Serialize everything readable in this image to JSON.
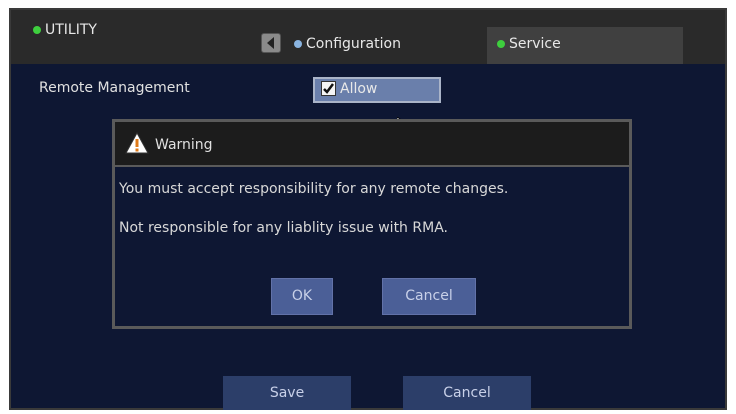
{
  "header": {
    "title": "UTILITY",
    "title_dot_color": "#3ecf3e",
    "back_icon": "chevron-left-icon",
    "tabs": [
      {
        "label": "Configuration",
        "dot_color": "#8ab4e0"
      },
      {
        "label": "Service",
        "dot_color": "#3ecf3e"
      }
    ]
  },
  "settings": {
    "remote_label": "Remote Management",
    "allow_label": "Allow",
    "allow_checked": true
  },
  "dialog": {
    "title": "Warning",
    "icon": "warning-icon",
    "line1": "You must accept responsibility for any remote changes.",
    "line2": "Not responsible for any liablity issue with RMA.",
    "ok_label": "OK",
    "cancel_label": "Cancel"
  },
  "footer": {
    "save_label": "Save",
    "cancel_label": "Cancel"
  },
  "colors": {
    "background": "#0e1733",
    "button": "#4b5f97"
  }
}
